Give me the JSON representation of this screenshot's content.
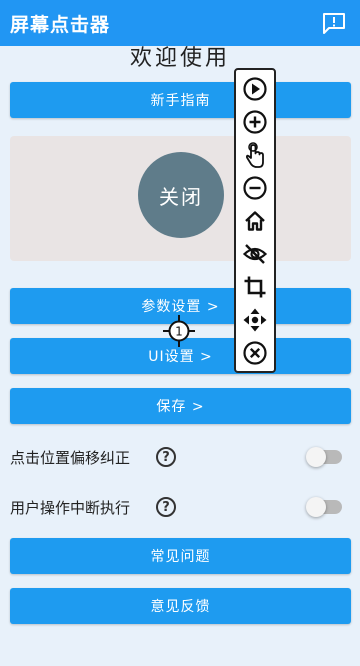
{
  "appbar": {
    "title": "屏幕点击器",
    "icon": "feedback-icon"
  },
  "main": {
    "welcome": "欢迎使用",
    "guide_button": "新手指南",
    "toggle_circle": "关闭",
    "params_button": "参数设置 >",
    "ui_button": "UI设置 >",
    "save_button": "保存 >",
    "options": [
      {
        "label": "点击位置偏移纠正",
        "help": "?",
        "enabled": false
      },
      {
        "label": "用户操作中断执行",
        "help": "?",
        "enabled": false
      }
    ],
    "faq_button": "常见问题",
    "feedback_button": "意见反馈"
  },
  "floating_toolbar": {
    "tools": [
      "play-icon",
      "add-icon",
      "tap-hand-icon",
      "remove-icon",
      "home-icon",
      "hide-eye-icon",
      "crop-icon",
      "move-icon",
      "close-icon"
    ]
  },
  "click_target": {
    "number": "1"
  },
  "colors": {
    "appbar": "#2196f3",
    "button": "#1e9bf0",
    "background": "#e8f1fa",
    "circle": "#5f7c8a"
  }
}
